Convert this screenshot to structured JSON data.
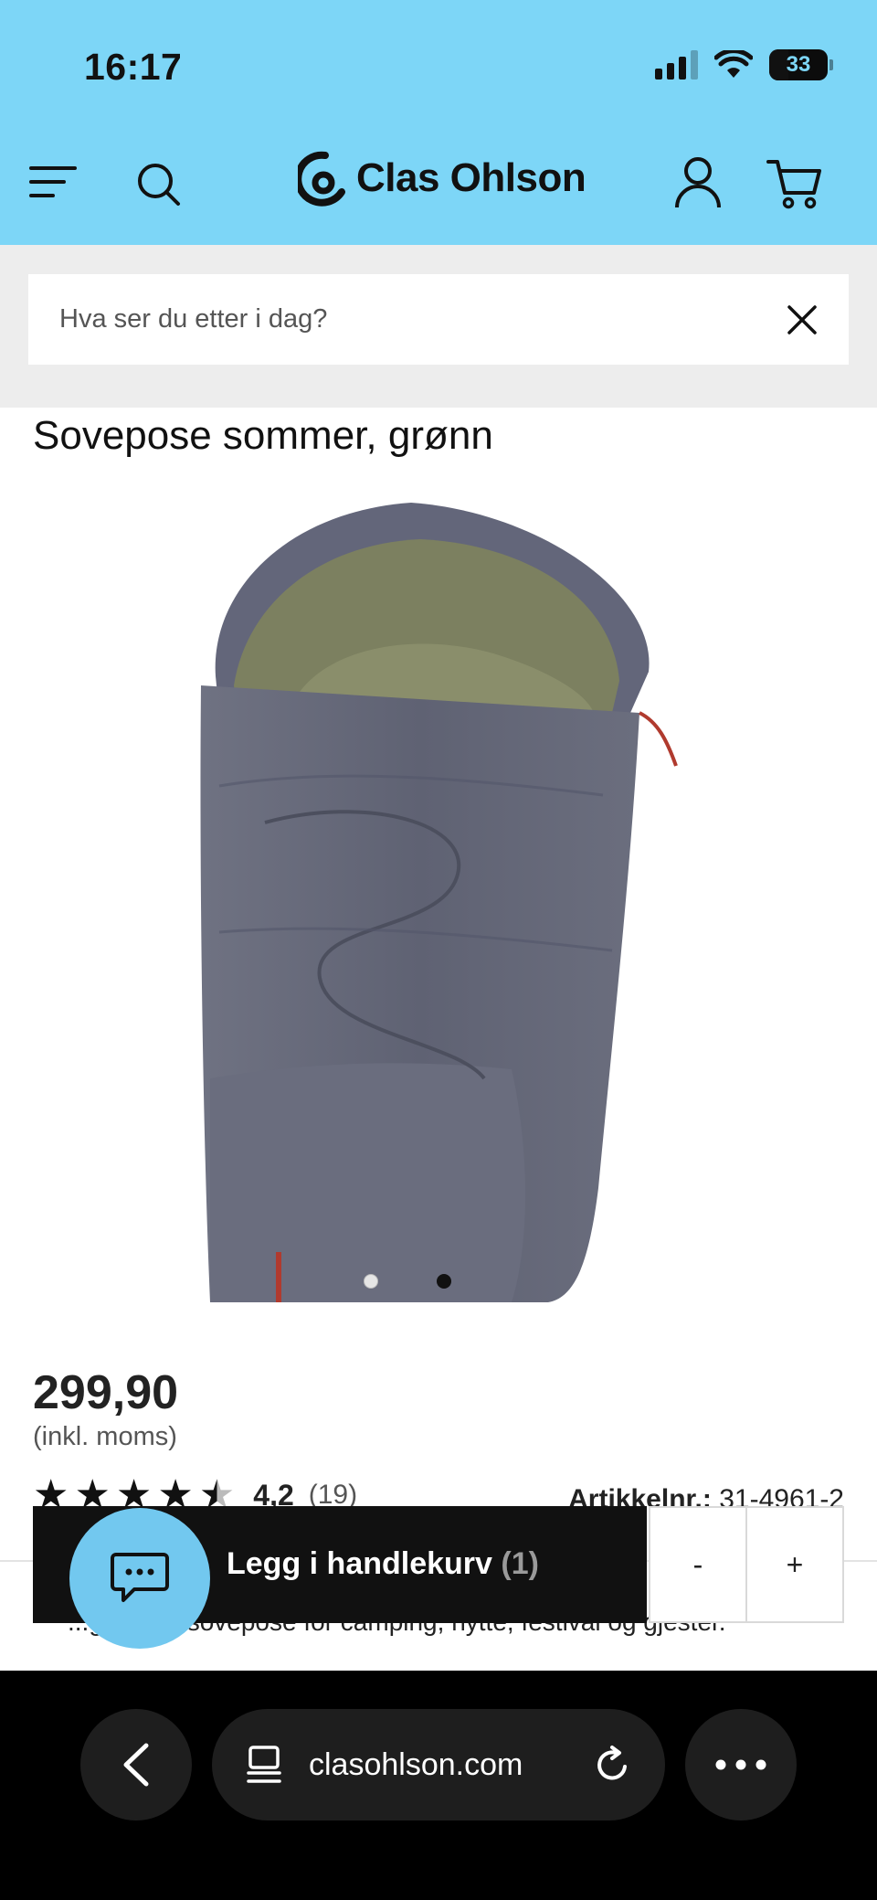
{
  "status_bar": {
    "time": "16:17",
    "battery": "33",
    "battery_level": 0.33
  },
  "header": {
    "brand": "Clas Ohlson",
    "icons": [
      "menu-icon",
      "search-icon",
      "clas-ohlson-logo",
      "account-icon",
      "cart-icon"
    ]
  },
  "search": {
    "placeholder": "Hva ser du etter i dag?"
  },
  "product": {
    "title": "Sovepose sommer, grønn",
    "price": "299,90",
    "price_note": "(inkl. moms)",
    "rating_value": "4,2",
    "rating_count": "(19)",
    "rating_stars": 4.2,
    "article_label": "Artikkelnr.:",
    "article_number": "31-4961-2",
    "description": "...g mumiesovepose for camping, hytte, festival og gjester.",
    "image_count": 2,
    "active_image_index": 1
  },
  "cart": {
    "add_label": "Legg i handlekurv",
    "count": "(1)",
    "minus": "-",
    "plus": "+"
  },
  "browser": {
    "url": "clasohlson.com"
  },
  "colors": {
    "header_bg": "#7dd6f7",
    "search_bg": "#ededed",
    "cart_bar_bg": "#111111",
    "chat_bg": "#72c8ef",
    "browser_bg": "#000000"
  }
}
